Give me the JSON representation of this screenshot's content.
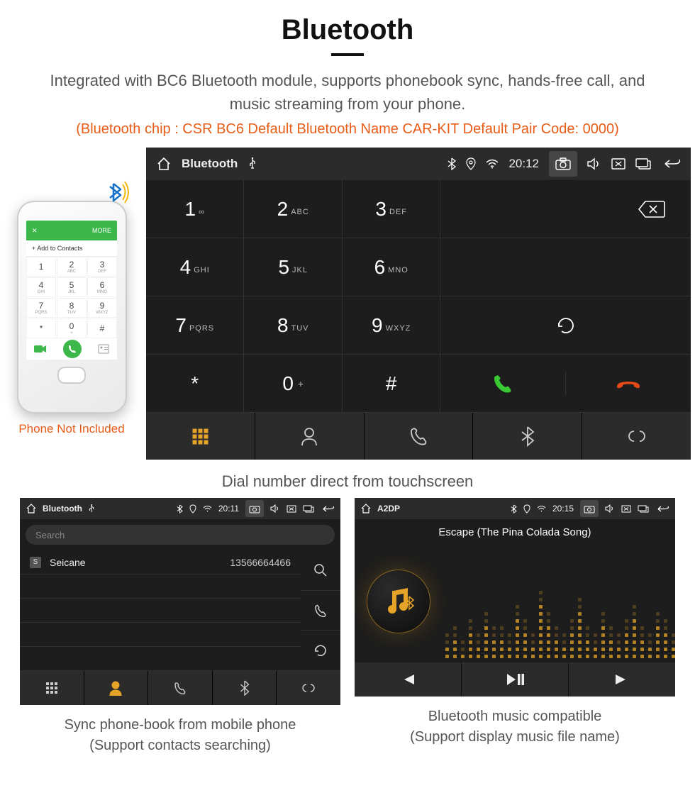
{
  "header": {
    "title": "Bluetooth",
    "description": "Integrated with BC6 Bluetooth module, supports phonebook sync, hands-free call, and music streaming from your phone.",
    "spec": "(Bluetooth chip : CSR BC6    Default Bluetooth Name CAR-KIT    Default Pair Code: 0000)"
  },
  "phone_mock": {
    "top_left": "✕",
    "top_right": "MORE",
    "add_contacts": "+   Add to Contacts",
    "caption": "Phone Not Included",
    "keys": [
      {
        "n": "1",
        "s": ""
      },
      {
        "n": "2",
        "s": "ABC"
      },
      {
        "n": "3",
        "s": "DEF"
      },
      {
        "n": "4",
        "s": "GHI"
      },
      {
        "n": "5",
        "s": "JKL"
      },
      {
        "n": "6",
        "s": "MNO"
      },
      {
        "n": "7",
        "s": "PQRS"
      },
      {
        "n": "8",
        "s": "TUV"
      },
      {
        "n": "9",
        "s": "WXYZ"
      },
      {
        "n": "*",
        "s": ""
      },
      {
        "n": "0",
        "s": "+"
      },
      {
        "n": "#",
        "s": ""
      }
    ]
  },
  "dialer": {
    "status": {
      "title": "Bluetooth",
      "time": "20:12"
    },
    "keypad": [
      {
        "n": "1",
        "s": "∞"
      },
      {
        "n": "2",
        "s": "ABC"
      },
      {
        "n": "3",
        "s": "DEF"
      },
      {
        "n": "4",
        "s": "GHI"
      },
      {
        "n": "5",
        "s": "JKL"
      },
      {
        "n": "6",
        "s": "MNO"
      },
      {
        "n": "7",
        "s": "PQRS"
      },
      {
        "n": "8",
        "s": "TUV"
      },
      {
        "n": "9",
        "s": "WXYZ"
      },
      {
        "n": "*",
        "s": ""
      },
      {
        "n": "0",
        "sup": "+"
      },
      {
        "n": "#",
        "s": ""
      }
    ],
    "caption": "Dial number direct from touchscreen"
  },
  "phonebook_panel": {
    "status": {
      "title": "Bluetooth",
      "time": "20:11"
    },
    "search_placeholder": "Search",
    "contact": {
      "badge": "S",
      "name": "Seicane",
      "phone": "13566664466"
    },
    "caption_line1": "Sync phone-book from mobile phone",
    "caption_line2": "(Support contacts searching)"
  },
  "music_panel": {
    "status": {
      "title": "A2DP",
      "time": "20:15"
    },
    "song": "Escape (The Pina Colada Song)",
    "caption_line1": "Bluetooth music compatible",
    "caption_line2": "(Support display music file name)",
    "eq_heights": [
      2,
      3,
      1,
      4,
      2,
      5,
      3,
      3,
      2,
      6,
      4,
      2,
      8,
      5,
      3,
      2,
      4,
      7,
      3,
      2,
      5,
      3,
      2,
      4,
      6,
      3,
      2,
      5,
      4,
      2,
      3,
      1,
      2,
      4,
      3,
      2
    ]
  }
}
